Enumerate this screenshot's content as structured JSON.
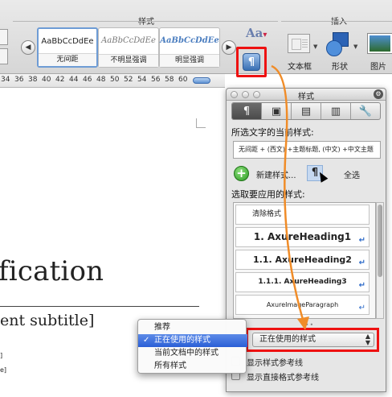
{
  "ribbon": {
    "styles_group_title": "样式",
    "insert_group_title": "插入",
    "style_tiles": [
      {
        "sample": "AaBbCcDdEe",
        "name": "无间距"
      },
      {
        "sample": "AaBbCcDdEe",
        "name": "不明显强调"
      },
      {
        "sample": "AaBbCcDdEe",
        "name": "明显强调"
      }
    ],
    "aa_text": "Aa",
    "styles_button_glyph": "¶",
    "insert_items": [
      {
        "label": "文本框",
        "icon": "text-box-icon"
      },
      {
        "label": "形状",
        "icon": "shape-icon"
      },
      {
        "label": "图片",
        "icon": "picture-icon"
      }
    ]
  },
  "ruler": {
    "ticks": [
      "34",
      "36",
      "38",
      "40",
      "42",
      "44",
      "46",
      "48",
      "50",
      "52",
      "54",
      "56",
      "58",
      "60"
    ]
  },
  "document": {
    "title_fragment": "fication",
    "subtitle_fragment": "ent subtitle]",
    "small_fragments": [
      "]",
      "e]"
    ]
  },
  "palette": {
    "title": "样式",
    "gear_glyph": "⚙",
    "tabs": [
      "¶",
      "▣",
      "▤",
      "▥",
      "🔧"
    ],
    "current_style_label": "所选文字的当前样式:",
    "current_style_value": "无间距 + (西文) +主题标题, (中文) +中文主题",
    "new_style_glyph": "+",
    "new_style_label": "新建样式...",
    "pilcrow": "¶",
    "select_all_label": "全选",
    "apply_label": "选取要应用的样式:",
    "styles": [
      {
        "name": "清除格式",
        "arrow": ""
      },
      {
        "name": "1.  AxureHeading1",
        "arrow": "↵"
      },
      {
        "name": "1.1.  AxureHeading2",
        "arrow": "↵"
      },
      {
        "name": "1.1.1.  AxureHeading3",
        "arrow": "↵"
      },
      {
        "name": "AxureImageParagraph",
        "arrow": "↵"
      }
    ],
    "show_value": "正在使用的样式",
    "show_updown": "▲▼",
    "checkbox_show_guides": "显示样式参考线",
    "checkbox_show_direct": "显示直接格式参考线"
  },
  "popup_menu": {
    "items": [
      {
        "label": "推荐",
        "selected": false
      },
      {
        "label": "正在使用的样式",
        "selected": true
      },
      {
        "label": "当前文档中的样式",
        "selected": false
      },
      {
        "label": "所有样式",
        "selected": false
      }
    ],
    "check": "✓"
  },
  "colors": {
    "highlight_frame": "#e11111",
    "annotation_arrow": "#f08c28",
    "menu_selection": "#2a5fd6"
  }
}
